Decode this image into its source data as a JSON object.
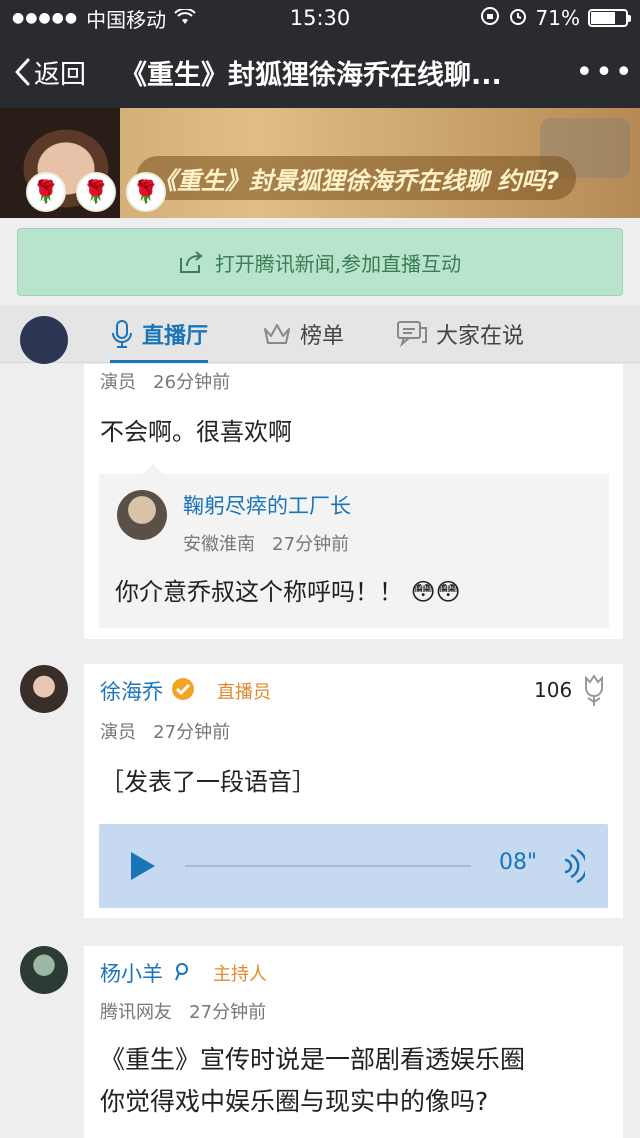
{
  "status": {
    "signal_dots": "●●●●●",
    "carrier": "中国移动",
    "time": "15:30",
    "battery": "71%",
    "battery_level": 0.71
  },
  "nav": {
    "back_label": "返回",
    "title": "《重生》封狐狸徐海乔在线聊...",
    "more_label": "•••"
  },
  "banner": {
    "text": "《重生》封景狐狸徐海乔在线聊  约吗?"
  },
  "open_app": {
    "label": "打开腾讯新闻,参加直播互动"
  },
  "tabs": [
    {
      "label": "直播厅",
      "active": true
    },
    {
      "label": "榜单",
      "active": false
    },
    {
      "label": "大家在说",
      "active": false
    }
  ],
  "posts": [
    {
      "meta": "演员",
      "time": "26分钟前",
      "content": "不会啊。很喜欢啊",
      "quote": {
        "name": "鞠躬尽瘁的工厂长",
        "location": "安徽淮南",
        "time": "27分钟前",
        "content": "你介意乔叔这个称呼吗！！ 😳😳"
      }
    },
    {
      "name": "徐海乔",
      "role": "直播员",
      "likes": "106",
      "meta": "演员",
      "time": "27分钟前",
      "content": "［发表了一段语音］",
      "audio_duration": "08\""
    },
    {
      "name": "杨小羊",
      "role": "主持人",
      "meta": "腾讯网友",
      "time": "27分钟前",
      "content_line1": "《重生》宣传时说是一部剧看透娱乐圈",
      "content_line2": "你觉得戏中娱乐圈与现实中的像吗?"
    }
  ]
}
